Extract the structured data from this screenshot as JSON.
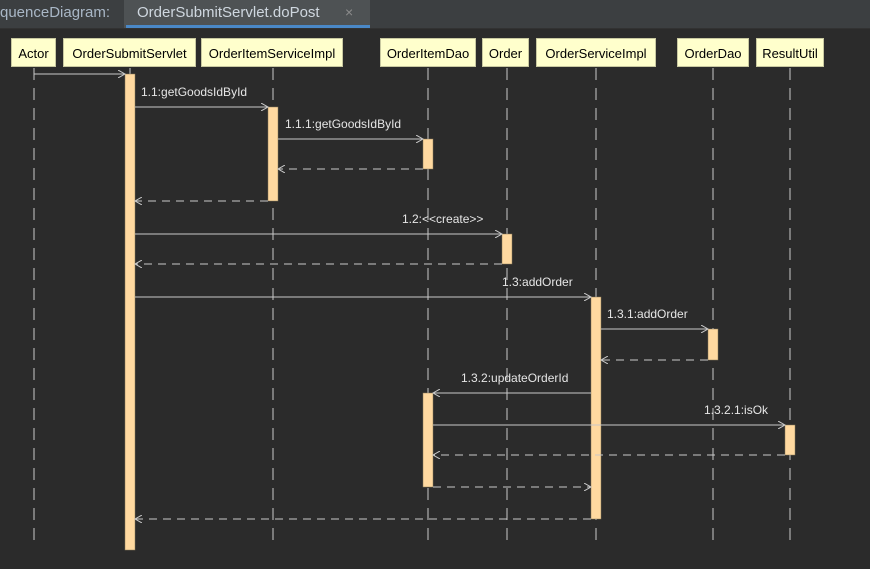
{
  "window": {
    "title_prefix": "quenceDiagram:",
    "tab_label": "OrderSubmitServlet.doPost",
    "tab_close": "×"
  },
  "participants": [
    "Actor",
    "OrderSubmitServlet",
    "OrderItemServiceImpl",
    "OrderItemDao",
    "Order",
    "OrderServiceImpl",
    "OrderDao",
    "ResultUtil"
  ],
  "messages": [
    "1.1:getGoodsIdById",
    "1.1.1:getGoodsIdById",
    "1.2:<<create>>",
    "1.3:addOrder",
    "1.3.1:addOrder",
    "1.3.2:updateOrderId",
    "1.3.2.1:isOk"
  ],
  "colors": {
    "background": "#2b2b2b",
    "participant_fill": "#ffffcc",
    "activation_fill": "#ffd9a0",
    "line": "#c8c8c8",
    "tab_underline": "#4a88c7"
  }
}
